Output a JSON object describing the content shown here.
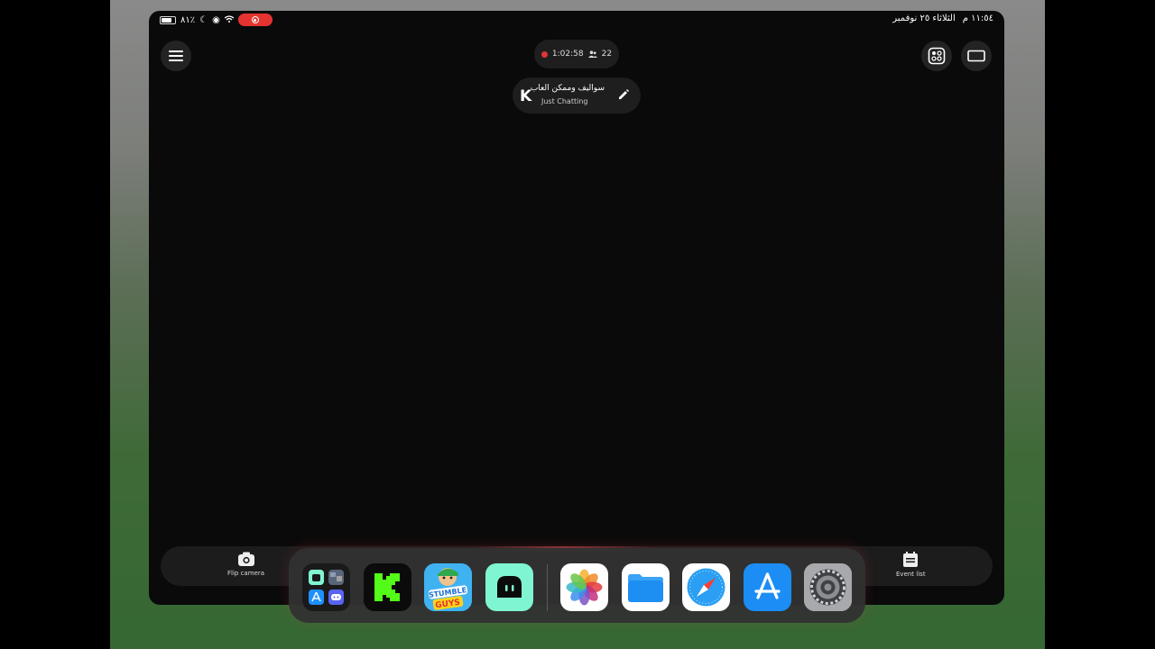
{
  "status_bar": {
    "battery": "٨١٪",
    "time": "١١:٥٤ م",
    "date": "الثلاثاء ٢٥ نوفمبر"
  },
  "stream": {
    "duration": "1:02:58",
    "viewers": "22",
    "title": "سواليف وممكن العاب",
    "category": "Just Chatting",
    "platform_logo": "K"
  },
  "bottom_bar": {
    "flip_camera_label": "Flip camera",
    "event_list_label": "Event list"
  },
  "dock": {
    "apps": [
      {
        "name": "app-folder-icon"
      },
      {
        "name": "kick-icon"
      },
      {
        "name": "stumble-guys-icon"
      },
      {
        "name": "streamlabs-icon"
      },
      {
        "name": "photos-icon"
      },
      {
        "name": "files-icon"
      },
      {
        "name": "safari-icon"
      },
      {
        "name": "app-store-icon"
      },
      {
        "name": "settings-icon"
      }
    ],
    "stumble_guys_text": [
      "STUMBLE",
      "GUYS"
    ]
  },
  "colors": {
    "live_red": "#e0353a",
    "kick_green": "#53fc18",
    "streamlabs_mint": "#80f5d2"
  }
}
